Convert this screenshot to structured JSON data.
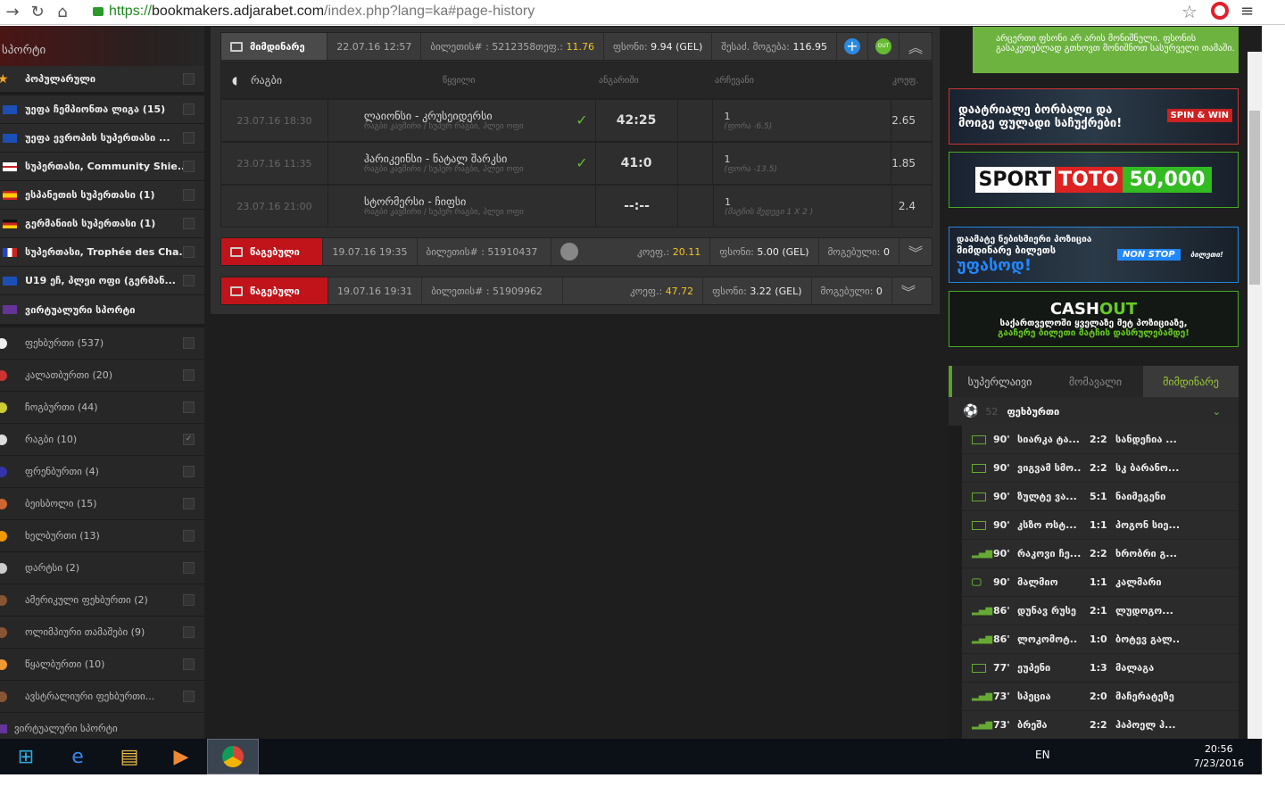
{
  "browser": {
    "url_secure": "https://",
    "url_host": "bookmakers.adjarabet.com",
    "url_path": "/index.php?lang=ka#page-history"
  },
  "sidebar": {
    "title": "სპორტი",
    "popular": "პოპულარული",
    "leagues": [
      {
        "label": "უეფა ჩემპიონთა ლიგა (15)",
        "flag": "eu"
      },
      {
        "label": "უეფა ევროპის სუპერთასი ...",
        "flag": "eu"
      },
      {
        "label": "სუპერთასი, Community Shie...",
        "flag": "en"
      },
      {
        "label": "ესპანეთის სუპერთასი (1)",
        "flag": "es"
      },
      {
        "label": "გერმანიის სუპერთასი (1)",
        "flag": "de"
      },
      {
        "label": "სუპერთასი, Trophée des Cha...",
        "flag": "fr"
      },
      {
        "label": "U19 ეჩ, პლეი ოფი (გერმან...",
        "flag": "eu"
      }
    ],
    "virtual": "ვირტუალური სპორტი",
    "sports": [
      {
        "label": "ფეხბურთი (537)",
        "color": "#eee",
        "checked": false
      },
      {
        "label": "კალათბურთი (20)",
        "color": "#c33",
        "checked": false
      },
      {
        "label": "ჩოგბურთი (44)",
        "color": "#cc3",
        "checked": false
      },
      {
        "label": "რაგბი (10)",
        "color": "#ddd",
        "checked": true
      },
      {
        "label": "ფრენბურთი (4)",
        "color": "#33a",
        "checked": false
      },
      {
        "label": "ბეისბოლი (15)",
        "color": "#c63",
        "checked": false
      },
      {
        "label": "ხელბურთი (13)",
        "color": "#e90",
        "checked": false
      },
      {
        "label": "დარტსი (2)",
        "color": "#ccc",
        "checked": false
      },
      {
        "label": "ამერიკული ფეხბურთი (2)",
        "color": "#853",
        "checked": false
      },
      {
        "label": "ოლიმპიური თამაშები (9)",
        "color": "#853",
        "checked": false
      },
      {
        "label": "წყალბურთი (10)",
        "color": "#e93",
        "checked": false
      },
      {
        "label": "ავსტრალიური ფეხბურთი...",
        "color": "#853",
        "checked": false
      }
    ],
    "virtual2": "ვირტუალური სპორტი"
  },
  "ticket_current": {
    "status": "მიმდინარე",
    "date": "22.07.16 12:57",
    "ticket_label": "ბილეთის# : 5212358",
    "coef_label": "თეფ.:",
    "coef": "11.76",
    "stake_label": "ფსონი:",
    "stake": "9.94 (GEL)",
    "payout_label": "შესაძ. მოგება:",
    "payout": "116.95",
    "out_label": "OUT"
  },
  "table": {
    "sport": "რაგბი",
    "col_event": "წყვილი",
    "col_score": "ანგარიში",
    "col_pick": "არჩევანი",
    "col_coef": "კოეფ.",
    "rows": [
      {
        "date": "23.07.16 18:30",
        "teams": "ლაიონსი - კრუსეიდერსი",
        "league": "რაგბი კავშირი / სუპერ რაგბი, პლეი ოფი",
        "won": true,
        "score": "42:25",
        "pick": "1",
        "market": "(ფორა -6.5)",
        "coef": "2.65"
      },
      {
        "date": "23.07.16 11:35",
        "teams": "ჰარიკეინსი - ნატალ შარკსი",
        "league": "რაგბი კავშირი / სუპერ რაგბი, პლეი ოფი",
        "won": true,
        "score": "41:0",
        "pick": "1",
        "market": "(ფორა -13.5)",
        "coef": "1.85"
      },
      {
        "date": "23.07.16 21:00",
        "teams": "სტორმერსი - ჩიფსი",
        "league": "რაგბი კავშირი / სუპერ რაგბი, პლეი ოფი",
        "won": false,
        "score": "--:--",
        "pick": "1",
        "market": "(მატჩის შედეგი 1 X 2 )",
        "coef": "2.4"
      }
    ]
  },
  "lost_tickets": [
    {
      "status": "წაგებული",
      "date": "19.07.16 19:35",
      "ticket": "ბილეთის# : 51910437",
      "coef_label": "კოეფ.:",
      "coef": "20.11",
      "stake_label": "ფსონი:",
      "stake": "5.00 (GEL)",
      "win_label": "მოგებული:",
      "win": "0"
    },
    {
      "status": "წაგებული",
      "date": "19.07.16 19:31",
      "ticket": "ბილეთის# : 51909962",
      "coef_label": "კოეფ.:",
      "coef": "47.72",
      "stake_label": "ფსონი:",
      "stake": "3.22 (GEL)",
      "win_label": "მოგებული:",
      "win": "0"
    }
  ],
  "ads": {
    "notice": "არცერთი ფსონი არ არის მონიშნული. ფსონის გასაკეთებლად გთხოვთ მონიშნოთ სასურველი თამაში.",
    "spin_line1": "დაატრიალე ბორბალი და",
    "spin_line2": "მოიგე ფულადი საჩუქრები!",
    "spin_badge": "SPIN & WIN",
    "toto_a": "SPORT",
    "toto_b": "TOTO",
    "toto_prize": "50,000",
    "ns_line1": "დაამატე ნებისმიერი პოზიცია",
    "ns_line2": "მიმდინარე ბილეთს",
    "ns_line3": "უფასოდ!",
    "ns_badge": "NON STOP",
    "ns_sub": "ბილეთი!",
    "co_title_a": "CASH",
    "co_title_b": "OUT",
    "co_line1": "საქართველოში ყველაზე მეტ პოზიციაზე,",
    "co_line2": "გააჩერე ბილეთი მატჩის დასრულებამდე!"
  },
  "live": {
    "tabs": [
      "სუპერლაივი",
      "მომავალი",
      "მიმდინარე"
    ],
    "sport_count": "52",
    "sport": "ფეხბურთი",
    "matches": [
      {
        "icon": "field",
        "min": "90'",
        "home": "სიარკა ტა...",
        "score": "2:2",
        "away": "სანდეჩია ..."
      },
      {
        "icon": "field",
        "min": "90'",
        "home": "ვიგვამ სმო..",
        "score": "2:2",
        "away": "სკ ბარანო..."
      },
      {
        "icon": "field",
        "min": "90'",
        "home": "ზულტე ვა...",
        "score": "5:1",
        "away": "ნაიმეგენი"
      },
      {
        "icon": "field",
        "min": "90'",
        "home": "კსზო ოსტ...",
        "score": "1:1",
        "away": "პოგონ სიე..."
      },
      {
        "icon": "stats",
        "min": "90'",
        "home": "რაკოვი ჩე...",
        "score": "2:2",
        "away": "ხრობრი გ..."
      },
      {
        "icon": "tv",
        "min": "90'",
        "home": "მალმიო",
        "score": "1:1",
        "away": "კალმარი"
      },
      {
        "icon": "stats",
        "min": "86'",
        "home": "დუნავ რუსე",
        "score": "2:1",
        "away": "ლუდოგო..."
      },
      {
        "icon": "stats",
        "min": "86'",
        "home": "ლოკომოტ..",
        "score": "1:0",
        "away": "ბოტევ გალ.."
      },
      {
        "icon": "field",
        "min": "77'",
        "home": "ეუპენი",
        "score": "1:3",
        "away": "მალაგა"
      },
      {
        "icon": "stats",
        "min": "73'",
        "home": "სპეცია",
        "score": "2:0",
        "away": "მაჩერატეზე"
      },
      {
        "icon": "stats",
        "min": "73'",
        "home": "ბრეშა",
        "score": "2:2",
        "away": "ჰაპოელ ჰ..."
      }
    ]
  },
  "taskbar": {
    "lang": "EN",
    "time": "20:56",
    "date": "7/23/2016"
  }
}
